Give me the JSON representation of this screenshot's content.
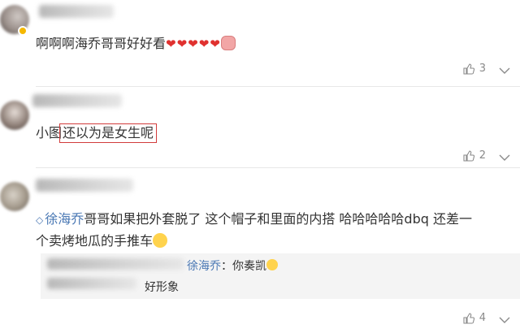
{
  "comments": [
    {
      "text": "啊啊啊海乔哥哥好好看",
      "hearts": "❤❤❤❤❤",
      "trailing_emoji": "pig-face-emoji",
      "like_count": "3"
    },
    {
      "text_plain": "小图",
      "text_highlighted": "还以为是女生呢",
      "highlight_color": "#d23c3c",
      "like_count": "2"
    },
    {
      "mention": "徐海乔",
      "text_line1": "哥哥如果把外套脱了 这个帽子和里面的内搭 哈哈哈哈哈dbq 还差一",
      "text_line2": "个卖烤地瓜的手推车",
      "trailing_emoji": "laughing-emoji",
      "replies": [
        {
          "author": "徐海乔",
          "separator": "：",
          "text": "你奏凯",
          "emoji": "shy-emoji"
        },
        {
          "text": "好形象"
        }
      ],
      "like_count": "4"
    }
  ],
  "colors": {
    "mention": "#4a78b4",
    "meta": "#8a8a8a",
    "reply_bg": "#f4f4f4"
  }
}
